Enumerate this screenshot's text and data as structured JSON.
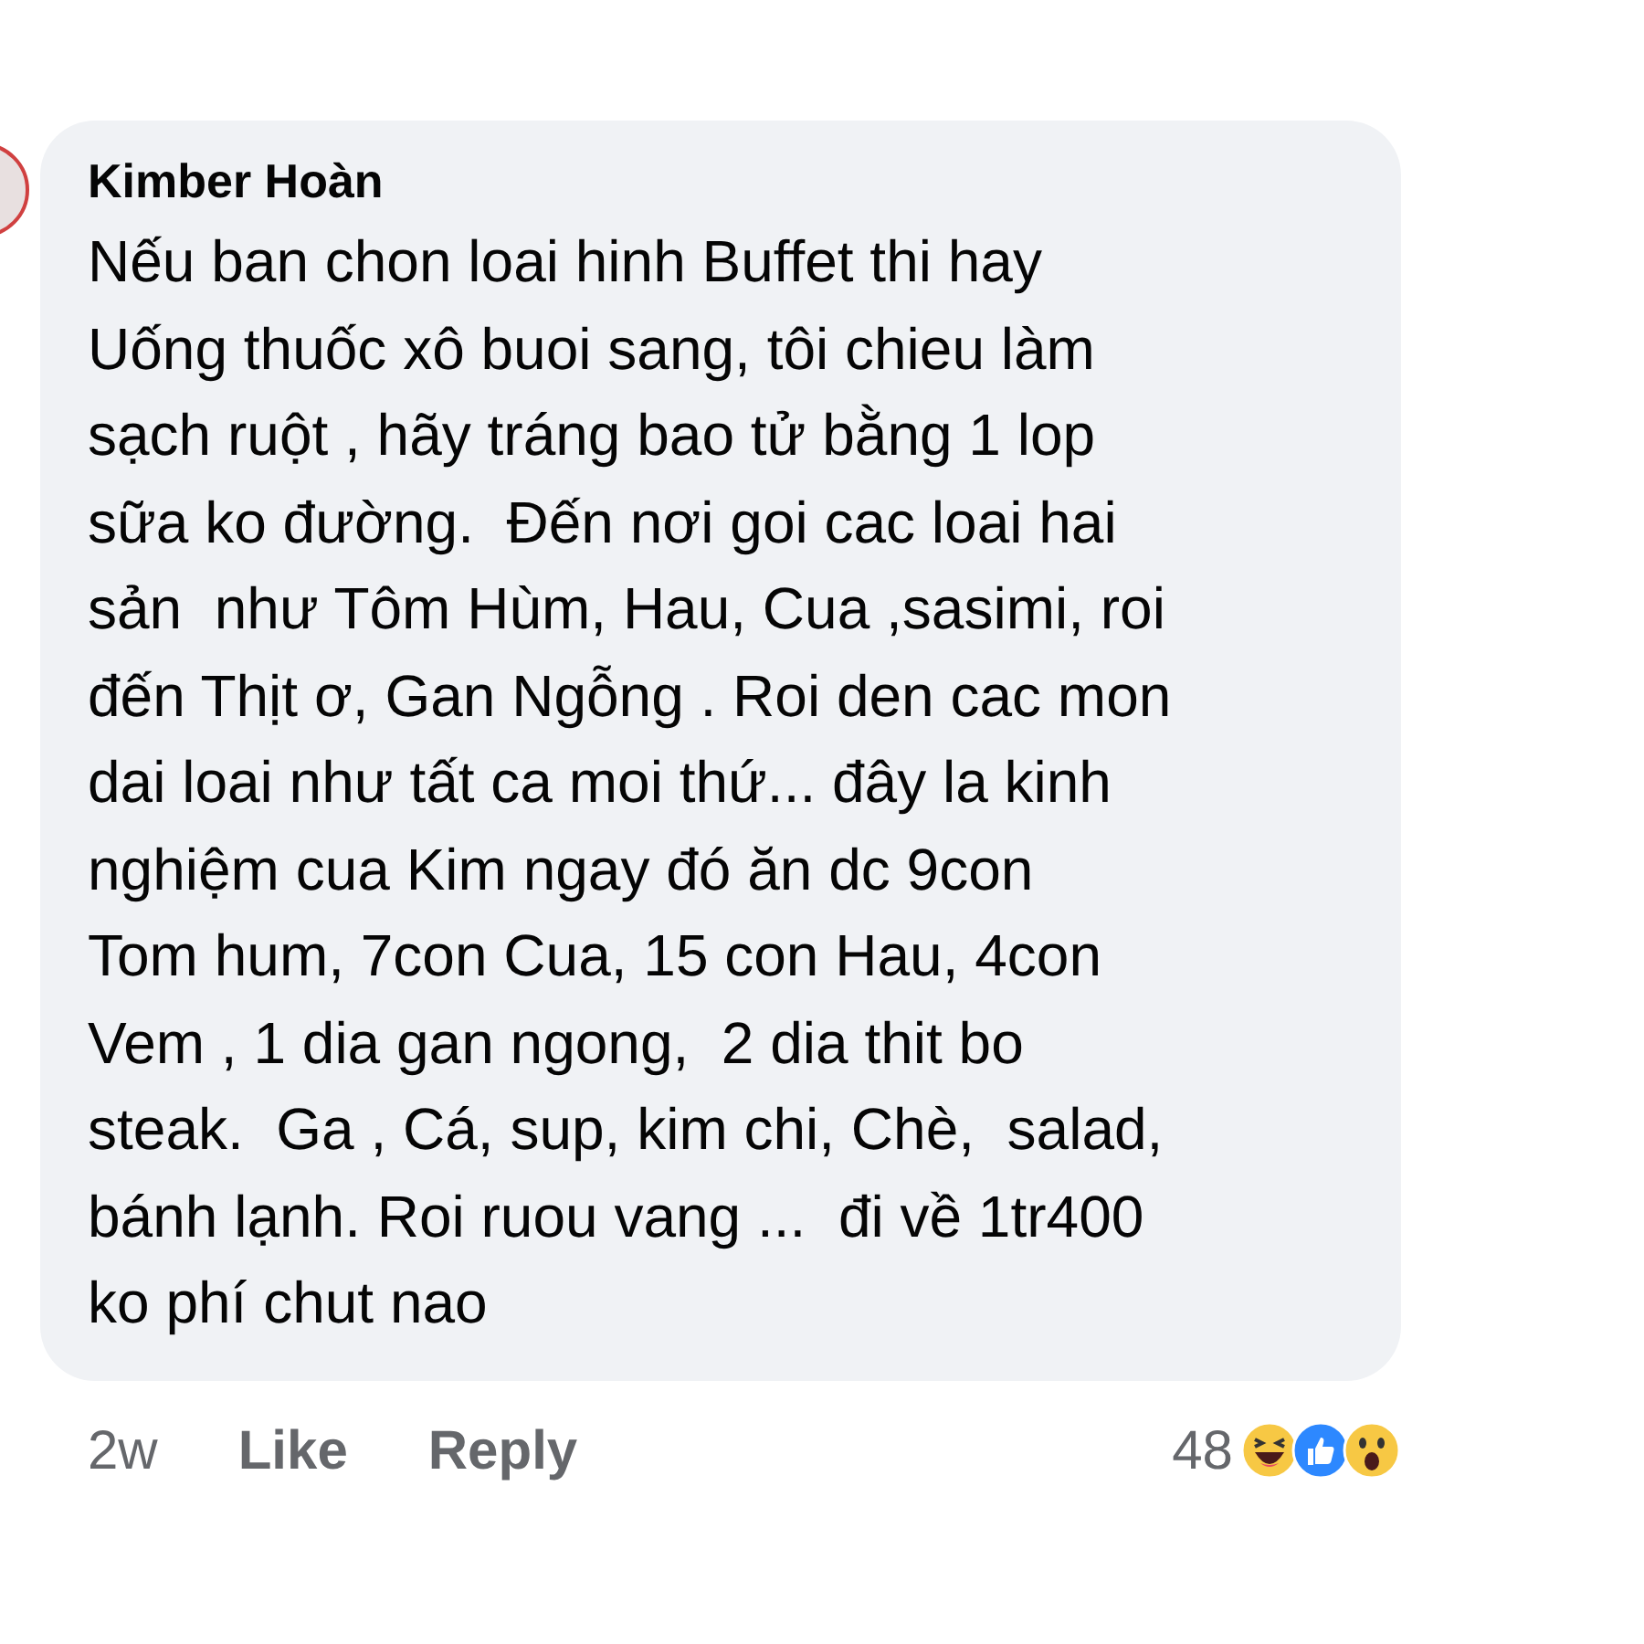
{
  "comment": {
    "author": "Kimber Hoàn",
    "lines": [
      "Nếu ban chon loai hinh Buffet thi hay",
      "Uống thuốc xô buoi sang, tôi chieu làm",
      "sạch ruột , hãy tráng bao tử bằng 1 lop",
      "sữa ko đường.  Đến nơi goi cac loai hai",
      "sản  như Tôm Hùm, Hau, Cua ,sasimi, roi",
      "đến Thịt ơ, Gan Ngỗng . Roi den cac mon",
      "dai loai như tất ca moi thứ... đây la kinh",
      "nghiệm cua Kim ngay đó ăn dc 9con",
      "Tom hum, 7con Cua, 15 con Hau, 4con",
      "Vem , 1 dia gan ngong,  2 dia thit bo",
      "steak.  Ga , Cá, sup, kim chi, Chè,  salad,",
      "bánh lạnh. Roi ruou vang ...  đi về 1tr400",
      "ko phí chut nao"
    ],
    "time": "2w",
    "actions": [
      "Like",
      "Reply"
    ],
    "reaction_count": "48",
    "reactions": [
      {
        "kind": "haha"
      },
      {
        "kind": "like"
      },
      {
        "kind": "wow"
      }
    ]
  }
}
